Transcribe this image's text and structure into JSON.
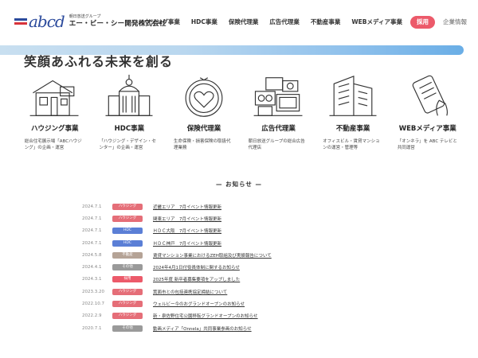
{
  "header": {
    "logo_mark": "abcd",
    "logo_subtitle": "朝日放送グループ",
    "company_name": "エー・ビー・シー開発株式会社",
    "nav": [
      {
        "label": "ハウジング事業"
      },
      {
        "label": "HDC事業"
      },
      {
        "label": "保険代理業"
      },
      {
        "label": "広告代理業"
      },
      {
        "label": "不動産事業"
      },
      {
        "label": "WEBメディア事業"
      }
    ],
    "recruit_label": "採用",
    "company_label": "企業情報"
  },
  "hero": {
    "title": "笑顔あふれる未来を創る"
  },
  "services": [
    {
      "icon": "house-icon",
      "title": "ハウジング事業",
      "desc": "総合住宅展示場「ABCハウジング」の企画・運営"
    },
    {
      "icon": "building-icon",
      "title": "HDC事業",
      "desc": "「ハウジング・デザイン・センター」の企画・運営"
    },
    {
      "icon": "heart-icon",
      "title": "保険代理業",
      "desc": "生命保険・損害保険の取扱代理業務"
    },
    {
      "icon": "media-icon",
      "title": "広告代理業",
      "desc": "朝日放送グループの総合広告代理店"
    },
    {
      "icon": "office-building-icon",
      "title": "不動産事業",
      "desc": "オフィスビル・賃貸マンションの運営・管理等"
    },
    {
      "icon": "smartphone-icon",
      "title": "WEBメディア事業",
      "desc": "「オンネラ」を ABC テレビと共同運営"
    }
  ],
  "news": {
    "heading": "— お知らせ —",
    "items": [
      {
        "date": "2024.7.1",
        "category": "ハウジング",
        "color": "#e56e78",
        "title": "近畿エリア　7月イベント情報更新"
      },
      {
        "date": "2024.7.1",
        "category": "ハウジング",
        "color": "#e56e78",
        "title": "関東エリア　7月イベント情報更新"
      },
      {
        "date": "2024.7.1",
        "category": "HDC",
        "color": "#5b7fd6",
        "title": "ＨＤＣ大阪　7月イベント情報更新"
      },
      {
        "date": "2024.7.1",
        "category": "HDC",
        "color": "#5b7fd6",
        "title": "ＨＤＣ神戸　7月イベント情報更新"
      },
      {
        "date": "2024.5.8",
        "category": "不動産",
        "color": "#b5a396",
        "title": "賃貸マンション事業におけるZEH取組及び実績報告について"
      },
      {
        "date": "2024.4.1",
        "category": "その他",
        "color": "#9a9a9a",
        "title": "2024年4月1日付役員体制に関するお知らせ"
      },
      {
        "date": "2024.3.1",
        "category": "採用",
        "color": "#ec5a6a",
        "title": "2025年度 新卒者募集要項をアップしました"
      },
      {
        "date": "2023.3.20",
        "category": "ハウジング",
        "color": "#e56e78",
        "title": "箕面市との包括連携協定締結について"
      },
      {
        "date": "2022.10.7",
        "category": "ハウジング",
        "color": "#e56e78",
        "title": "ウェルビー今のおグランドオープンのお知らせ"
      },
      {
        "date": "2022.2.9",
        "category": "ハウジング",
        "color": "#e56e78",
        "title": "新・泉佐野住宅公園移転グランドオープンのお知らせ"
      },
      {
        "date": "2020.7.1",
        "category": "その他",
        "color": "#9a9a9a",
        "title": "動画メディア「Onnela」共同事業参画のお知らせ"
      }
    ]
  }
}
